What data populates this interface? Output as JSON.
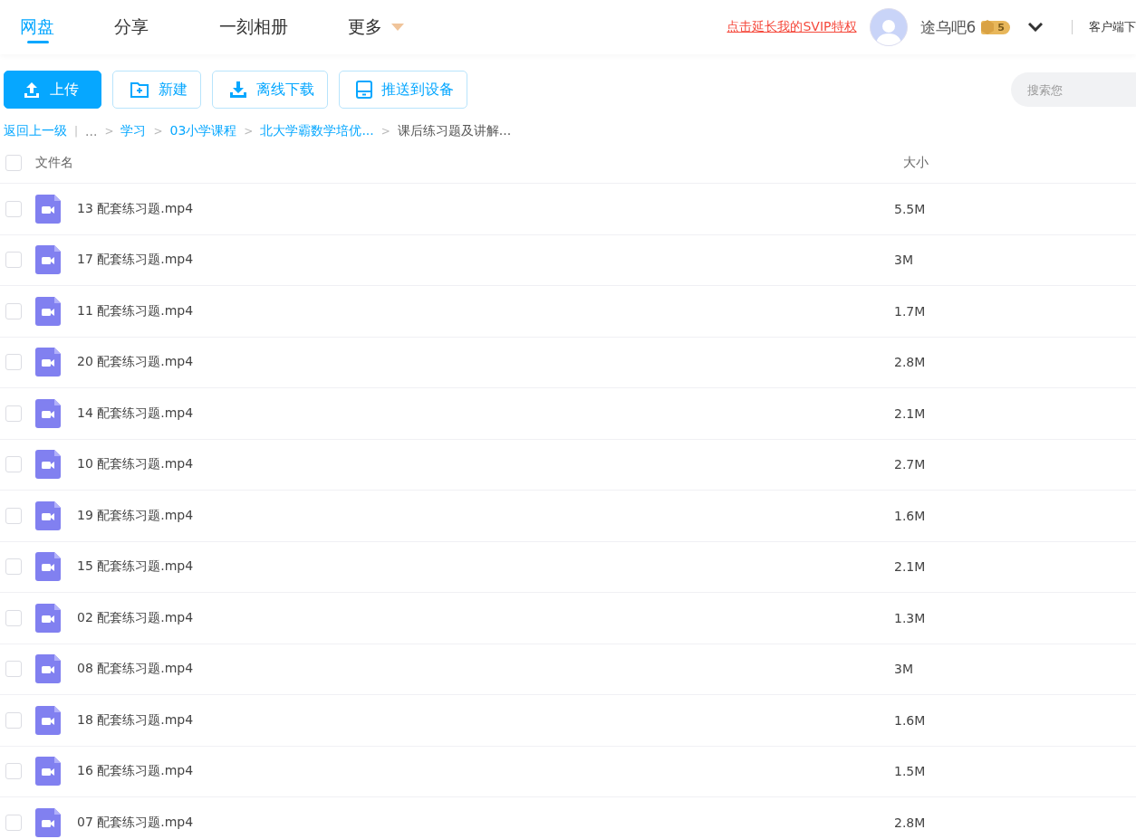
{
  "nav": {
    "tabs": [
      {
        "label": "网盘",
        "selected": true
      },
      {
        "label": "分享",
        "selected": false
      },
      {
        "label": "一刻相册",
        "selected": false
      },
      {
        "label": "更多",
        "selected": false,
        "dropdown": true
      }
    ],
    "promo_link": "点击延长我的SVIP特权",
    "user": {
      "name": "途乌吧6",
      "badge": "5"
    },
    "client_link": "客户端下"
  },
  "toolbar": {
    "buttons": [
      {
        "label": "上传",
        "kind": "upload",
        "primary": true
      },
      {
        "label": "新建",
        "kind": "folder",
        "primary": false
      },
      {
        "label": "离线下载",
        "kind": "download",
        "primary": false
      },
      {
        "label": "推送到设备",
        "kind": "device",
        "primary": false
      }
    ],
    "search": {
      "placeholder": "搜索您"
    }
  },
  "breadcrumb": {
    "back": "返回上一级",
    "divider": "|",
    "ellipsis": "...",
    "separator": ">",
    "items": [
      {
        "label": "学习",
        "current": false
      },
      {
        "label": "03小学课程",
        "current": false
      },
      {
        "label": "北大学霸数学培优...",
        "current": false
      },
      {
        "label": "课后练习题及讲解...",
        "current": true
      }
    ]
  },
  "table": {
    "all_checked": false,
    "columns": [
      "文件名",
      "大小"
    ],
    "rows": [
      {
        "name": "13 配套练习题.mp4",
        "size": "5.5M",
        "checked": false
      },
      {
        "name": "17 配套练习题.mp4",
        "size": "3M",
        "checked": false
      },
      {
        "name": "11 配套练习题.mp4",
        "size": "1.7M",
        "checked": false
      },
      {
        "name": "20 配套练习题.mp4",
        "size": "2.8M",
        "checked": false
      },
      {
        "name": "14 配套练习题.mp4",
        "size": "2.1M",
        "checked": false
      },
      {
        "name": "10 配套练习题.mp4",
        "size": "2.7M",
        "checked": false
      },
      {
        "name": "19 配套练习题.mp4",
        "size": "1.6M",
        "checked": false
      },
      {
        "name": "15 配套练习题.mp4",
        "size": "2.1M",
        "checked": false
      },
      {
        "name": "02 配套练习题.mp4",
        "size": "1.3M",
        "checked": false
      },
      {
        "name": "08 配套练习题.mp4",
        "size": "3M",
        "checked": false
      },
      {
        "name": "18 配套练习题.mp4",
        "size": "1.6M",
        "checked": false
      },
      {
        "name": "16 配套练习题.mp4",
        "size": "1.5M",
        "checked": false
      },
      {
        "name": "07 配套练习题.mp4",
        "size": "2.8M",
        "checked": false
      }
    ]
  }
}
